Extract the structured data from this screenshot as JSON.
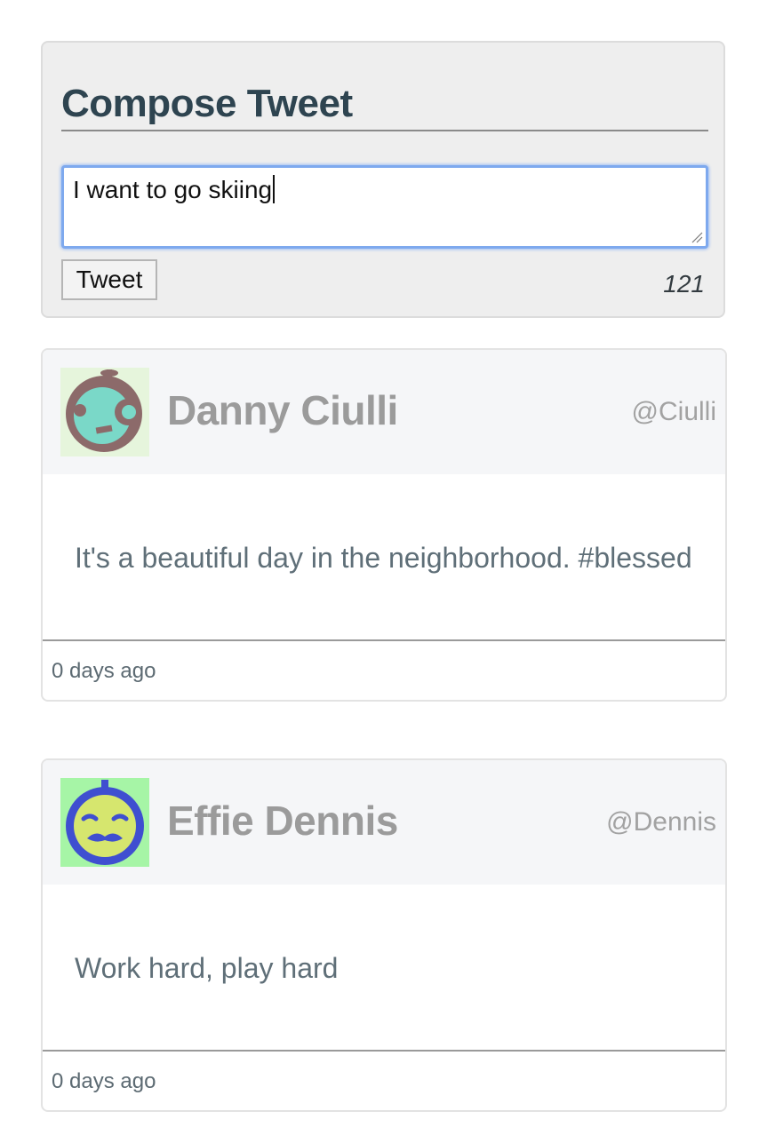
{
  "compose": {
    "title": "Compose Tweet",
    "input_value": "I want to go skiing",
    "button_label": "Tweet",
    "char_count": "121"
  },
  "tweets": [
    {
      "name": "Danny Ciulli",
      "handle": "@Ciulli",
      "text": "It's a beautiful day in the neighborhood. #blessed",
      "time": "0 days ago",
      "avatar_icon": "robot-face-avatar-icon",
      "avatar_colors": {
        "background": "#e6f5dc",
        "head": "#8c6a6a",
        "face": "#7ad8c8"
      }
    },
    {
      "name": "Effie Dennis",
      "handle": "@Dennis",
      "text": "Work hard, play hard",
      "time": "0 days ago",
      "avatar_icon": "mustache-face-avatar-icon",
      "avatar_colors": {
        "background": "#a6f5a6",
        "head": "#3f4fd0",
        "face": "#d6e66e"
      }
    }
  ],
  "colors": {
    "heading": "#2e4450",
    "focus_ring": "#7ea9ee",
    "name_text": "#9b9b9b",
    "body_text": "#5f6f78"
  }
}
